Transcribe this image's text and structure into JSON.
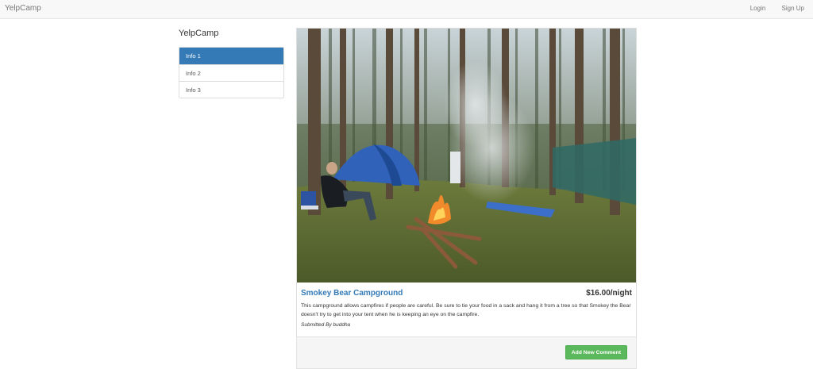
{
  "navbar": {
    "brand": "YelpCamp",
    "login": "Login",
    "signup": "Sign Up"
  },
  "sidebar": {
    "title": "YelpCamp",
    "items": [
      {
        "label": "Info 1",
        "active": true
      },
      {
        "label": "Info 2",
        "active": false
      },
      {
        "label": "Info 3",
        "active": false
      }
    ]
  },
  "campground": {
    "name": "Smokey Bear Campground",
    "price": "$16.00/night",
    "description": "This campground allows campfires if people are careful. Be sure to tie your food in a sack and hang it from a tree so that Smokey the Bear doesn't try to get into your tent when he is keeping an eye on the campfire.",
    "submitted_prefix": "Submitted By",
    "author": "buddha"
  },
  "comments": {
    "add_label": "Add New Comment"
  },
  "colors": {
    "primary": "#337ab7",
    "success": "#5cb85c",
    "navbar_bg": "#f8f8f8"
  }
}
